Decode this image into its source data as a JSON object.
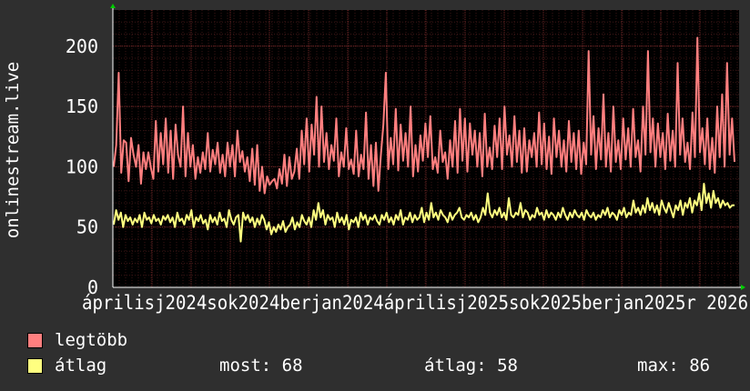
{
  "chart_data": {
    "type": "line",
    "title": "",
    "ylabel": "onlinestream.live",
    "xlabel": "",
    "ylim": [
      0,
      230
    ],
    "yticks": [
      0,
      50,
      100,
      150,
      200
    ],
    "xtick_labels": [
      "április",
      "július",
      "október",
      "január",
      "április",
      "július",
      "október",
      "január",
      "2024",
      "2024",
      "2024",
      "2025",
      "2025",
      "2025",
      "2025",
      "2026"
    ],
    "xlabels_row": "áprilisj2024sok2024berjan2024áprilisj2025sok2025berjan2025r 2026",
    "grid": true,
    "background": "#000000",
    "grid_color": "#5a2020",
    "series": [
      {
        "name": "legtöbb",
        "color": "#ff7f7f",
        "values": [
          100,
          118,
          178,
          95,
          122,
          120,
          88,
          124,
          110,
          100,
          118,
          86,
          112,
          98,
          112,
          99,
          90,
          138,
          96,
          128,
          102,
          140,
          95,
          130,
          90,
          135,
          110,
          100,
          150,
          92,
          128,
          100,
          118,
          90,
          108,
          95,
          112,
          98,
          128,
          96,
          114,
          102,
          120,
          95,
          110,
          92,
          120,
          100,
          118,
          92,
          130,
          104,
          113,
          96,
          108,
          88,
          115,
          85,
          118,
          80,
          100,
          78,
          92,
          85,
          88,
          90,
          82,
          98,
          86,
          110,
          84,
          108,
          90,
          96,
          115,
          90,
          130,
          102,
          140,
          96,
          135,
          110,
          158,
          100,
          150,
          104,
          128,
          98,
          118,
          105,
          140,
          92,
          112,
          100,
          132,
          98,
          106,
          94,
          130,
          92,
          110,
          98,
          145,
          90,
          118,
          84,
          120,
          80,
          110,
          135,
          178,
          98,
          124,
          102,
          148,
          97,
          135,
          105,
          128,
          100,
          150,
          92,
          118,
          96,
          126,
          105,
          136,
          108,
          142,
          98,
          108,
          95,
          130,
          104,
          112,
          90,
          122,
          100,
          138,
          95,
          148,
          105,
          140,
          96,
          136,
          110,
          130,
          100,
          128,
          92,
          144,
          100,
          116,
          98,
          134,
          108,
          140,
          98,
          150,
          110,
          126,
          100,
          142,
          104,
          130,
          95,
          132,
          96,
          122,
          108,
          128,
          100,
          145,
          102,
          136,
          98,
          125,
          94,
          140,
          108,
          130,
          100,
          122,
          96,
          138,
          104,
          128,
          98,
          130,
          94,
          120,
          102,
          196,
          110,
          142,
          98,
          132,
          106,
          160,
          100,
          128,
          96,
          150,
          104,
          122,
          98,
          140,
          106,
          132,
          100,
          148,
          108,
          122,
          96,
          150,
          110,
          196,
          112,
          140,
          100,
          136,
          108,
          128,
          98,
          144,
          105,
          130,
          100,
          186,
          110,
          140,
          104,
          120,
          98,
          145,
          108,
          207,
          112,
          132,
          102,
          140,
          98,
          124,
          95,
          150,
          108,
          160,
          100,
          186,
          110,
          140,
          104
        ]
      },
      {
        "name": "átlag",
        "color": "#ffff80",
        "values": [
          52,
          64,
          56,
          62,
          50,
          60,
          55,
          58,
          52,
          57,
          54,
          60,
          50,
          62,
          56,
          58,
          53,
          60,
          55,
          57,
          52,
          59,
          56,
          60,
          54,
          58,
          50,
          62,
          55,
          57,
          52,
          60,
          56,
          64,
          50,
          58,
          55,
          60,
          53,
          56,
          48,
          60,
          54,
          58,
          52,
          62,
          55,
          57,
          50,
          64,
          56,
          52,
          58,
          60,
          38,
          62,
          56,
          60,
          54,
          58,
          50,
          57,
          52,
          60,
          56,
          48,
          54,
          44,
          50,
          46,
          52,
          48,
          55,
          46,
          50,
          52,
          58,
          48,
          54,
          50,
          60,
          55,
          52,
          58,
          50,
          64,
          56,
          70,
          58,
          64,
          52,
          60,
          56,
          58,
          50,
          62,
          54,
          58,
          52,
          60,
          48,
          56,
          54,
          58,
          50,
          62,
          56,
          60,
          52,
          58,
          56,
          60,
          55,
          52,
          60,
          56,
          62,
          54,
          58,
          52,
          60,
          56,
          64,
          52,
          58,
          56,
          62,
          54,
          60,
          56,
          58,
          66,
          54,
          62,
          56,
          70,
          58,
          62,
          56,
          64,
          60,
          58,
          54,
          62,
          56,
          60,
          62,
          66,
          58,
          56,
          60,
          58,
          62,
          56,
          60,
          54,
          58,
          66,
          60,
          78,
          62,
          58,
          64,
          60,
          66,
          58,
          62,
          56,
          74,
          60,
          58,
          62,
          60,
          70,
          58,
          64,
          62,
          56,
          60,
          58,
          66,
          60,
          62,
          56,
          64,
          58,
          62,
          60,
          56,
          62,
          58,
          66,
          60,
          56,
          62,
          58,
          64,
          60,
          58,
          62,
          56,
          64,
          60,
          58,
          62,
          56,
          60,
          58,
          64,
          60,
          66,
          58,
          62,
          60,
          56,
          64,
          60,
          66,
          58,
          62,
          60,
          72,
          62,
          66,
          60,
          68,
          62,
          74,
          64,
          70,
          62,
          68,
          60,
          72,
          66,
          62,
          70,
          64,
          58,
          68,
          64,
          72,
          60,
          70,
          66,
          74,
          62,
          72,
          68,
          78,
          64,
          86,
          70,
          78,
          66,
          80,
          70,
          74,
          66,
          72,
          68,
          70,
          66,
          68,
          68
        ]
      }
    ]
  },
  "legend": {
    "items": [
      {
        "label": "legtöbb",
        "color": "#ff7f7f"
      },
      {
        "label": "átlag",
        "color": "#ffff80"
      }
    ],
    "stats": {
      "now": "most: 68",
      "avg": "átlag: 58",
      "max": "max: 86"
    }
  }
}
